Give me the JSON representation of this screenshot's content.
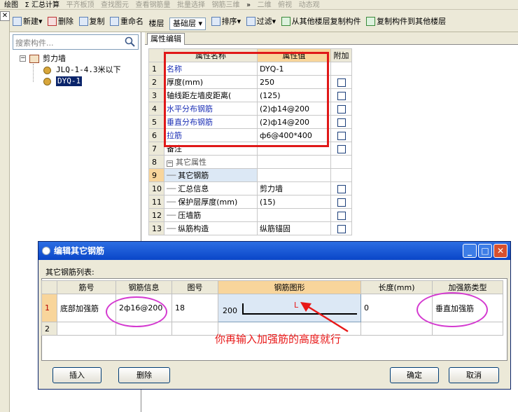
{
  "toolbar_top": {
    "items": [
      {
        "label": "绘图",
        "disabled": false
      },
      {
        "label": "Σ 汇总计算",
        "disabled": false
      },
      {
        "label": "平齐板顶",
        "disabled": true
      },
      {
        "label": "查找图元",
        "disabled": true
      },
      {
        "label": "查看钢筋量",
        "disabled": true
      },
      {
        "label": "批量选择",
        "disabled": true
      },
      {
        "label": "钢筋三维",
        "disabled": true
      },
      {
        "label": "»",
        "disabled": false
      },
      {
        "label": "二维",
        "disabled": true
      },
      {
        "label": "俯视",
        "disabled": true
      },
      {
        "label": "动态观",
        "disabled": true
      }
    ]
  },
  "toolbar_main": {
    "new_label": "新建",
    "delete_label": "删除",
    "copy_label": "复制",
    "rename_label": "重命名",
    "floor_label": "楼层",
    "floor_value": "基础层",
    "sort_label": "排序",
    "filter_label": "过滤",
    "copy_from_label": "从其他楼层复制构件",
    "copy_to_label": "复制构件到其他楼层"
  },
  "left_panel": {
    "search_placeholder": "搜索构件...",
    "tree": {
      "root": "剪力墙",
      "children": [
        "JLQ-1-4.3米以下",
        "DYQ-1"
      ],
      "selected": "DYQ-1"
    }
  },
  "property_panel": {
    "tab": "属性编辑",
    "headers": {
      "name": "属性名称",
      "value": "属性值",
      "extra": "附加"
    },
    "rows": [
      {
        "n": "1",
        "name": "名称",
        "value": "DYQ-1",
        "blue": true,
        "checkbox": false,
        "indent": 0
      },
      {
        "n": "2",
        "name": "厚度(mm)",
        "value": "250",
        "blue": false,
        "checkbox": true,
        "indent": 0
      },
      {
        "n": "3",
        "name": "轴线距左墙皮距离(",
        "value": "(125)",
        "blue": false,
        "checkbox": true,
        "indent": 0
      },
      {
        "n": "4",
        "name": "水平分布钢筋",
        "value": "(2)ф14@200",
        "blue": true,
        "checkbox": true,
        "indent": 0
      },
      {
        "n": "5",
        "name": "垂直分布钢筋",
        "value": "(2)ф14@200",
        "blue": true,
        "checkbox": true,
        "indent": 0
      },
      {
        "n": "6",
        "name": "拉筋",
        "value": "ф6@400*400",
        "blue": true,
        "checkbox": true,
        "indent": 0
      },
      {
        "n": "7",
        "name": "备注",
        "value": "",
        "blue": false,
        "checkbox": true,
        "indent": 0
      },
      {
        "n": "8",
        "name": "其它属性",
        "value": "",
        "blue": false,
        "checkbox": false,
        "indent": 0,
        "group": true
      },
      {
        "n": "9",
        "name": "其它钢筋",
        "value": "",
        "blue": false,
        "checkbox": false,
        "indent": 1,
        "selected": true
      },
      {
        "n": "10",
        "name": "汇总信息",
        "value": "剪力墙",
        "blue": false,
        "checkbox": true,
        "indent": 1
      },
      {
        "n": "11",
        "name": "保护层厚度(mm)",
        "value": "(15)",
        "blue": false,
        "checkbox": true,
        "indent": 1
      },
      {
        "n": "12",
        "name": "压墙筋",
        "value": "",
        "blue": false,
        "checkbox": true,
        "indent": 1
      },
      {
        "n": "13",
        "name": "纵筋构造",
        "value": "纵筋锚固",
        "blue": false,
        "checkbox": true,
        "indent": 1
      }
    ]
  },
  "dialog": {
    "title": "编辑其它钢筋",
    "list_label": "其它钢筋列表:",
    "columns": [
      "筋号",
      "钢筋信息",
      "图号",
      "钢筋图形",
      "长度(mm)",
      "加强筋类型"
    ],
    "rows": [
      {
        "n": "1",
        "bar": "底部加强筋",
        "info": "2ф16@200",
        "fig": "18",
        "shape_num": "200",
        "shape_mark": "L",
        "length": "0",
        "type": "垂直加强筋"
      },
      {
        "n": "2",
        "bar": "",
        "info": "",
        "fig": "",
        "shape_num": "",
        "shape_mark": "",
        "length": "",
        "type": ""
      }
    ],
    "annotation": "你再输入加强筋的高度就行",
    "buttons": {
      "insert": "插入",
      "delete": "删除",
      "ok": "确定",
      "cancel": "取消"
    }
  },
  "colors": {
    "annotation_red": "#e81818",
    "ellipse_magenta": "#d43ad0",
    "title_blue": "#0a46c8",
    "header_highlight": "#f8d59b"
  }
}
